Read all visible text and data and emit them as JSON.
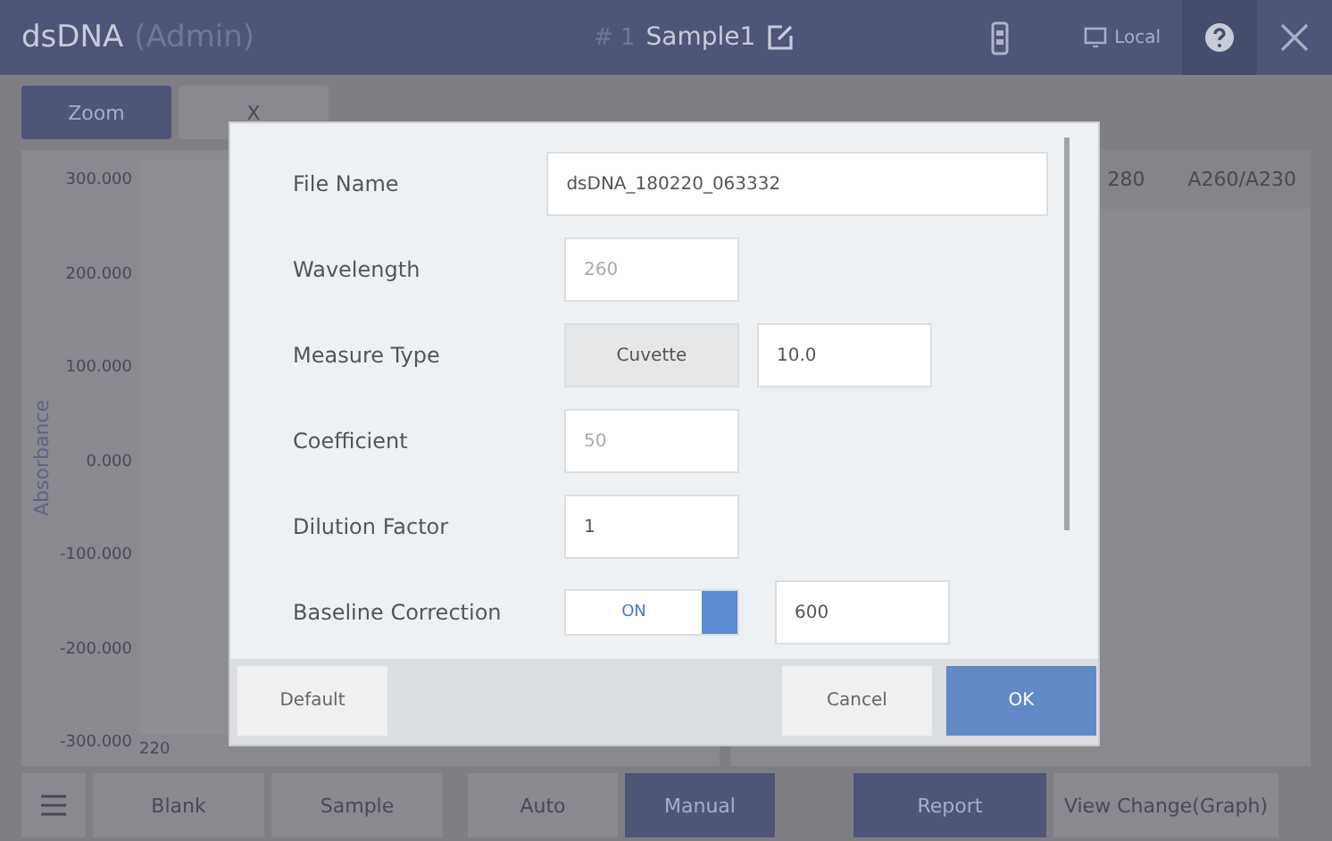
{
  "header": {
    "title": "dsDNA",
    "role": "(Admin)",
    "sample_number": "# 1",
    "sample_name": "Sample1",
    "location": "Local"
  },
  "toolbar_tabs": [
    {
      "label": "Zoom",
      "selected": true
    },
    {
      "label": "X",
      "selected": false
    }
  ],
  "chart": {
    "ylabel": "Absorbance",
    "yticks": [
      "300.000",
      "200.000",
      "100.000",
      "0.000",
      "-100.000",
      "-200.000",
      "-300.000"
    ],
    "xtick": "220"
  },
  "result_columns": [
    "280",
    "A260/A230"
  ],
  "dialog": {
    "fields": [
      {
        "kind": "input",
        "label": "File Name",
        "value": "dsDNA_180220_063332",
        "wide": true,
        "disabled": false
      },
      {
        "kind": "input",
        "label": "Wavelength",
        "value": "260",
        "disabled": true
      },
      {
        "kind": "choice",
        "label": "Measure Type",
        "option": "Cuvette",
        "value": "10.0"
      },
      {
        "kind": "input",
        "label": "Coefficient",
        "value": "50",
        "disabled": true
      },
      {
        "kind": "input",
        "label": "Dilution Factor",
        "value": "1",
        "disabled": false
      },
      {
        "kind": "toggle",
        "label": "Baseline Correction",
        "toggle_label": "ON",
        "on": true,
        "value": "600"
      }
    ],
    "buttons": [
      {
        "label": "Default",
        "kind": "plain"
      },
      {
        "label": "Cancel",
        "kind": "plain"
      },
      {
        "label": "OK",
        "kind": "primary"
      }
    ]
  },
  "bottom_bar": {
    "buttons": [
      "Blank",
      "Sample"
    ],
    "modes": [
      {
        "label": "Auto",
        "selected": false
      },
      {
        "label": "Manual",
        "selected": true
      }
    ],
    "actions": [
      {
        "label": "Report",
        "selected": true
      },
      {
        "label": "View Change(Graph)",
        "selected": false
      }
    ]
  }
}
